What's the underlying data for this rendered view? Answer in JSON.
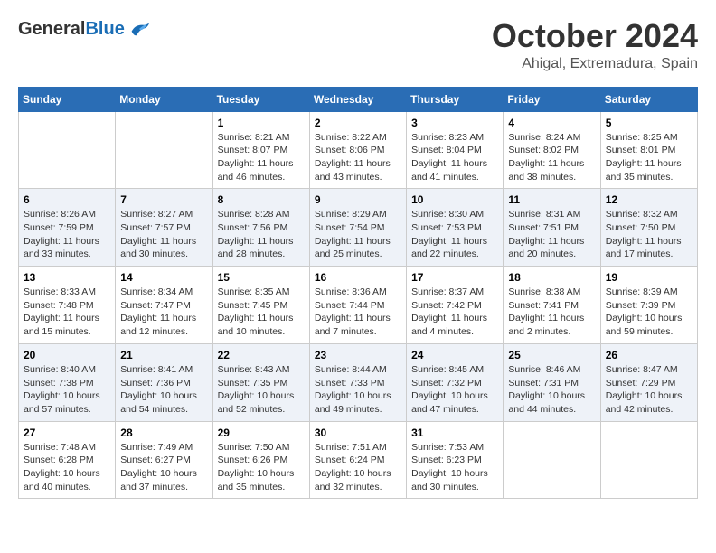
{
  "header": {
    "logo": {
      "general": "General",
      "blue": "Blue"
    },
    "title": "October 2024",
    "location": "Ahigal, Extremadura, Spain"
  },
  "calendar": {
    "days_of_week": [
      "Sunday",
      "Monday",
      "Tuesday",
      "Wednesday",
      "Thursday",
      "Friday",
      "Saturday"
    ],
    "weeks": [
      [
        {
          "day": "",
          "info": ""
        },
        {
          "day": "",
          "info": ""
        },
        {
          "day": "1",
          "sunrise": "Sunrise: 8:21 AM",
          "sunset": "Sunset: 8:07 PM",
          "daylight": "Daylight: 11 hours and 46 minutes."
        },
        {
          "day": "2",
          "sunrise": "Sunrise: 8:22 AM",
          "sunset": "Sunset: 8:06 PM",
          "daylight": "Daylight: 11 hours and 43 minutes."
        },
        {
          "day": "3",
          "sunrise": "Sunrise: 8:23 AM",
          "sunset": "Sunset: 8:04 PM",
          "daylight": "Daylight: 11 hours and 41 minutes."
        },
        {
          "day": "4",
          "sunrise": "Sunrise: 8:24 AM",
          "sunset": "Sunset: 8:02 PM",
          "daylight": "Daylight: 11 hours and 38 minutes."
        },
        {
          "day": "5",
          "sunrise": "Sunrise: 8:25 AM",
          "sunset": "Sunset: 8:01 PM",
          "daylight": "Daylight: 11 hours and 35 minutes."
        }
      ],
      [
        {
          "day": "6",
          "sunrise": "Sunrise: 8:26 AM",
          "sunset": "Sunset: 7:59 PM",
          "daylight": "Daylight: 11 hours and 33 minutes."
        },
        {
          "day": "7",
          "sunrise": "Sunrise: 8:27 AM",
          "sunset": "Sunset: 7:57 PM",
          "daylight": "Daylight: 11 hours and 30 minutes."
        },
        {
          "day": "8",
          "sunrise": "Sunrise: 8:28 AM",
          "sunset": "Sunset: 7:56 PM",
          "daylight": "Daylight: 11 hours and 28 minutes."
        },
        {
          "day": "9",
          "sunrise": "Sunrise: 8:29 AM",
          "sunset": "Sunset: 7:54 PM",
          "daylight": "Daylight: 11 hours and 25 minutes."
        },
        {
          "day": "10",
          "sunrise": "Sunrise: 8:30 AM",
          "sunset": "Sunset: 7:53 PM",
          "daylight": "Daylight: 11 hours and 22 minutes."
        },
        {
          "day": "11",
          "sunrise": "Sunrise: 8:31 AM",
          "sunset": "Sunset: 7:51 PM",
          "daylight": "Daylight: 11 hours and 20 minutes."
        },
        {
          "day": "12",
          "sunrise": "Sunrise: 8:32 AM",
          "sunset": "Sunset: 7:50 PM",
          "daylight": "Daylight: 11 hours and 17 minutes."
        }
      ],
      [
        {
          "day": "13",
          "sunrise": "Sunrise: 8:33 AM",
          "sunset": "Sunset: 7:48 PM",
          "daylight": "Daylight: 11 hours and 15 minutes."
        },
        {
          "day": "14",
          "sunrise": "Sunrise: 8:34 AM",
          "sunset": "Sunset: 7:47 PM",
          "daylight": "Daylight: 11 hours and 12 minutes."
        },
        {
          "day": "15",
          "sunrise": "Sunrise: 8:35 AM",
          "sunset": "Sunset: 7:45 PM",
          "daylight": "Daylight: 11 hours and 10 minutes."
        },
        {
          "day": "16",
          "sunrise": "Sunrise: 8:36 AM",
          "sunset": "Sunset: 7:44 PM",
          "daylight": "Daylight: 11 hours and 7 minutes."
        },
        {
          "day": "17",
          "sunrise": "Sunrise: 8:37 AM",
          "sunset": "Sunset: 7:42 PM",
          "daylight": "Daylight: 11 hours and 4 minutes."
        },
        {
          "day": "18",
          "sunrise": "Sunrise: 8:38 AM",
          "sunset": "Sunset: 7:41 PM",
          "daylight": "Daylight: 11 hours and 2 minutes."
        },
        {
          "day": "19",
          "sunrise": "Sunrise: 8:39 AM",
          "sunset": "Sunset: 7:39 PM",
          "daylight": "Daylight: 10 hours and 59 minutes."
        }
      ],
      [
        {
          "day": "20",
          "sunrise": "Sunrise: 8:40 AM",
          "sunset": "Sunset: 7:38 PM",
          "daylight": "Daylight: 10 hours and 57 minutes."
        },
        {
          "day": "21",
          "sunrise": "Sunrise: 8:41 AM",
          "sunset": "Sunset: 7:36 PM",
          "daylight": "Daylight: 10 hours and 54 minutes."
        },
        {
          "day": "22",
          "sunrise": "Sunrise: 8:43 AM",
          "sunset": "Sunset: 7:35 PM",
          "daylight": "Daylight: 10 hours and 52 minutes."
        },
        {
          "day": "23",
          "sunrise": "Sunrise: 8:44 AM",
          "sunset": "Sunset: 7:33 PM",
          "daylight": "Daylight: 10 hours and 49 minutes."
        },
        {
          "day": "24",
          "sunrise": "Sunrise: 8:45 AM",
          "sunset": "Sunset: 7:32 PM",
          "daylight": "Daylight: 10 hours and 47 minutes."
        },
        {
          "day": "25",
          "sunrise": "Sunrise: 8:46 AM",
          "sunset": "Sunset: 7:31 PM",
          "daylight": "Daylight: 10 hours and 44 minutes."
        },
        {
          "day": "26",
          "sunrise": "Sunrise: 8:47 AM",
          "sunset": "Sunset: 7:29 PM",
          "daylight": "Daylight: 10 hours and 42 minutes."
        }
      ],
      [
        {
          "day": "27",
          "sunrise": "Sunrise: 7:48 AM",
          "sunset": "Sunset: 6:28 PM",
          "daylight": "Daylight: 10 hours and 40 minutes."
        },
        {
          "day": "28",
          "sunrise": "Sunrise: 7:49 AM",
          "sunset": "Sunset: 6:27 PM",
          "daylight": "Daylight: 10 hours and 37 minutes."
        },
        {
          "day": "29",
          "sunrise": "Sunrise: 7:50 AM",
          "sunset": "Sunset: 6:26 PM",
          "daylight": "Daylight: 10 hours and 35 minutes."
        },
        {
          "day": "30",
          "sunrise": "Sunrise: 7:51 AM",
          "sunset": "Sunset: 6:24 PM",
          "daylight": "Daylight: 10 hours and 32 minutes."
        },
        {
          "day": "31",
          "sunrise": "Sunrise: 7:53 AM",
          "sunset": "Sunset: 6:23 PM",
          "daylight": "Daylight: 10 hours and 30 minutes."
        },
        {
          "day": "",
          "info": ""
        },
        {
          "day": "",
          "info": ""
        }
      ]
    ]
  }
}
